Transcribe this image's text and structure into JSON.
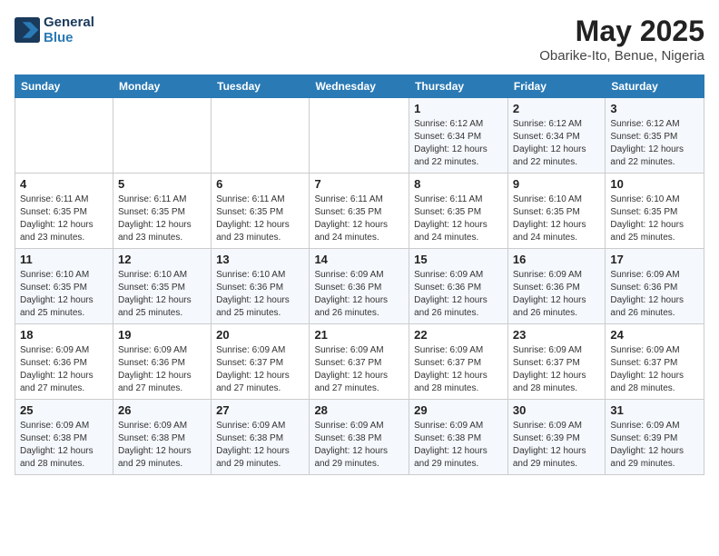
{
  "header": {
    "logo_line1": "General",
    "logo_line2": "Blue",
    "month": "May 2025",
    "location": "Obarike-Ito, Benue, Nigeria"
  },
  "weekdays": [
    "Sunday",
    "Monday",
    "Tuesday",
    "Wednesday",
    "Thursday",
    "Friday",
    "Saturday"
  ],
  "weeks": [
    [
      {
        "day": "",
        "info": ""
      },
      {
        "day": "",
        "info": ""
      },
      {
        "day": "",
        "info": ""
      },
      {
        "day": "",
        "info": ""
      },
      {
        "day": "1",
        "info": "Sunrise: 6:12 AM\nSunset: 6:34 PM\nDaylight: 12 hours\nand 22 minutes."
      },
      {
        "day": "2",
        "info": "Sunrise: 6:12 AM\nSunset: 6:34 PM\nDaylight: 12 hours\nand 22 minutes."
      },
      {
        "day": "3",
        "info": "Sunrise: 6:12 AM\nSunset: 6:35 PM\nDaylight: 12 hours\nand 22 minutes."
      }
    ],
    [
      {
        "day": "4",
        "info": "Sunrise: 6:11 AM\nSunset: 6:35 PM\nDaylight: 12 hours\nand 23 minutes."
      },
      {
        "day": "5",
        "info": "Sunrise: 6:11 AM\nSunset: 6:35 PM\nDaylight: 12 hours\nand 23 minutes."
      },
      {
        "day": "6",
        "info": "Sunrise: 6:11 AM\nSunset: 6:35 PM\nDaylight: 12 hours\nand 23 minutes."
      },
      {
        "day": "7",
        "info": "Sunrise: 6:11 AM\nSunset: 6:35 PM\nDaylight: 12 hours\nand 24 minutes."
      },
      {
        "day": "8",
        "info": "Sunrise: 6:11 AM\nSunset: 6:35 PM\nDaylight: 12 hours\nand 24 minutes."
      },
      {
        "day": "9",
        "info": "Sunrise: 6:10 AM\nSunset: 6:35 PM\nDaylight: 12 hours\nand 24 minutes."
      },
      {
        "day": "10",
        "info": "Sunrise: 6:10 AM\nSunset: 6:35 PM\nDaylight: 12 hours\nand 25 minutes."
      }
    ],
    [
      {
        "day": "11",
        "info": "Sunrise: 6:10 AM\nSunset: 6:35 PM\nDaylight: 12 hours\nand 25 minutes."
      },
      {
        "day": "12",
        "info": "Sunrise: 6:10 AM\nSunset: 6:35 PM\nDaylight: 12 hours\nand 25 minutes."
      },
      {
        "day": "13",
        "info": "Sunrise: 6:10 AM\nSunset: 6:36 PM\nDaylight: 12 hours\nand 25 minutes."
      },
      {
        "day": "14",
        "info": "Sunrise: 6:09 AM\nSunset: 6:36 PM\nDaylight: 12 hours\nand 26 minutes."
      },
      {
        "day": "15",
        "info": "Sunrise: 6:09 AM\nSunset: 6:36 PM\nDaylight: 12 hours\nand 26 minutes."
      },
      {
        "day": "16",
        "info": "Sunrise: 6:09 AM\nSunset: 6:36 PM\nDaylight: 12 hours\nand 26 minutes."
      },
      {
        "day": "17",
        "info": "Sunrise: 6:09 AM\nSunset: 6:36 PM\nDaylight: 12 hours\nand 26 minutes."
      }
    ],
    [
      {
        "day": "18",
        "info": "Sunrise: 6:09 AM\nSunset: 6:36 PM\nDaylight: 12 hours\nand 27 minutes."
      },
      {
        "day": "19",
        "info": "Sunrise: 6:09 AM\nSunset: 6:36 PM\nDaylight: 12 hours\nand 27 minutes."
      },
      {
        "day": "20",
        "info": "Sunrise: 6:09 AM\nSunset: 6:37 PM\nDaylight: 12 hours\nand 27 minutes."
      },
      {
        "day": "21",
        "info": "Sunrise: 6:09 AM\nSunset: 6:37 PM\nDaylight: 12 hours\nand 27 minutes."
      },
      {
        "day": "22",
        "info": "Sunrise: 6:09 AM\nSunset: 6:37 PM\nDaylight: 12 hours\nand 28 minutes."
      },
      {
        "day": "23",
        "info": "Sunrise: 6:09 AM\nSunset: 6:37 PM\nDaylight: 12 hours\nand 28 minutes."
      },
      {
        "day": "24",
        "info": "Sunrise: 6:09 AM\nSunset: 6:37 PM\nDaylight: 12 hours\nand 28 minutes."
      }
    ],
    [
      {
        "day": "25",
        "info": "Sunrise: 6:09 AM\nSunset: 6:38 PM\nDaylight: 12 hours\nand 28 minutes."
      },
      {
        "day": "26",
        "info": "Sunrise: 6:09 AM\nSunset: 6:38 PM\nDaylight: 12 hours\nand 29 minutes."
      },
      {
        "day": "27",
        "info": "Sunrise: 6:09 AM\nSunset: 6:38 PM\nDaylight: 12 hours\nand 29 minutes."
      },
      {
        "day": "28",
        "info": "Sunrise: 6:09 AM\nSunset: 6:38 PM\nDaylight: 12 hours\nand 29 minutes."
      },
      {
        "day": "29",
        "info": "Sunrise: 6:09 AM\nSunset: 6:38 PM\nDaylight: 12 hours\nand 29 minutes."
      },
      {
        "day": "30",
        "info": "Sunrise: 6:09 AM\nSunset: 6:39 PM\nDaylight: 12 hours\nand 29 minutes."
      },
      {
        "day": "31",
        "info": "Sunrise: 6:09 AM\nSunset: 6:39 PM\nDaylight: 12 hours\nand 29 minutes."
      }
    ]
  ]
}
